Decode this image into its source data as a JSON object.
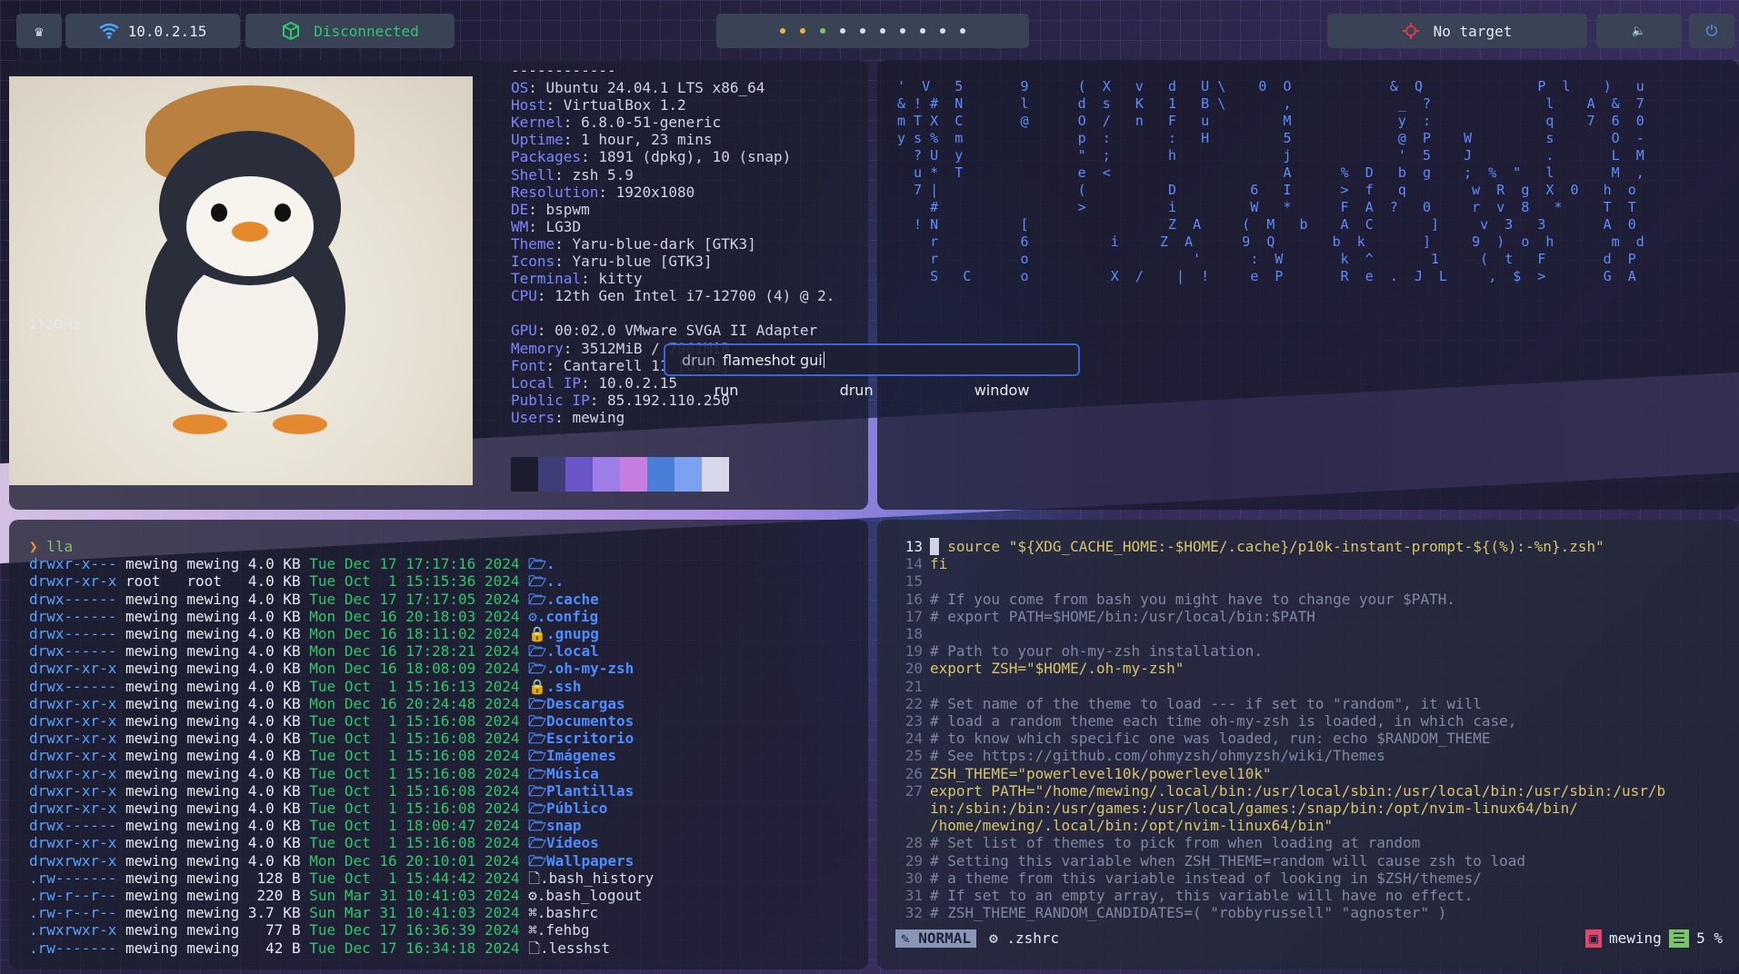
{
  "topbar": {
    "menu_icon": "♛",
    "network_ip": "10.0.2.15",
    "vpn_status": "Disconnected",
    "target_status": "No target",
    "volume_icon": "🔈",
    "power_icon": "⏻",
    "workspace_dot_colors": [
      "#e8b93a",
      "#e8b93a",
      "#7ec46a",
      "#d8dde9",
      "#d8dde9",
      "#d8dde9",
      "#d8dde9",
      "#d8dde9",
      "#d8dde9",
      "#d8dde9"
    ]
  },
  "fetch": {
    "separator": "------------",
    "lines": [
      {
        "key": "OS",
        "val": "Ubuntu 24.04.1 LTS x86_64"
      },
      {
        "key": "Host",
        "val": "VirtualBox 1.2"
      },
      {
        "key": "Kernel",
        "val": "6.8.0-51-generic"
      },
      {
        "key": "Uptime",
        "val": "1 hour, 23 mins"
      },
      {
        "key": "Packages",
        "val": "1891 (dpkg), 10 (snap)"
      },
      {
        "key": "Shell",
        "val": "zsh 5.9"
      },
      {
        "key": "Resolution",
        "val": "1920x1080"
      },
      {
        "key": "DE",
        "val": "bspwm"
      },
      {
        "key": "WM",
        "val": "LG3D"
      },
      {
        "key": "Theme",
        "val": "Yaru-blue-dark [GTK3]"
      },
      {
        "key": "Icons",
        "val": "Yaru-blue [GTK3]"
      },
      {
        "key": "Terminal",
        "val": "kitty"
      },
      {
        "key": "CPU",
        "val": "12th Gen Intel i7-12700 (4) @ 2."
      },
      {
        "key": "",
        "val": ""
      },
      {
        "key": "GPU",
        "val": "00:02.0 VMware SVGA II Adapter"
      },
      {
        "key": "Memory",
        "val": "3512MiB / 7961MiB"
      },
      {
        "key": "Font",
        "val": "Cantarell 11 [GTK3]"
      },
      {
        "key": "Local IP",
        "val": "10.0.2.15"
      },
      {
        "key": "Public IP",
        "val": "85.192.110.250"
      },
      {
        "key": "Users",
        "val": "mewing"
      }
    ],
    "ghz_label": "112GHz",
    "swatches": [
      "#1c1e30",
      "#3f3c7a",
      "#6a55c8",
      "#9e7de8",
      "#c77de0",
      "#4b7ed8",
      "#7aa2f0",
      "#d6d8ea"
    ]
  },
  "launcher": {
    "mode_prefix": "drun",
    "query": "flameshot gui",
    "modes": [
      "run",
      "drun",
      "window"
    ]
  },
  "ls": {
    "prompt_symbol": "❯",
    "command": "lla",
    "rows": [
      {
        "perm": "drwxr-x---",
        "user": "mewing",
        "group": "mewing",
        "size": "4.0 KB",
        "date": "Tue Dec 17 17:17:16 2024",
        "icon": "🗁",
        "name": ".",
        "dir": true
      },
      {
        "perm": "drwxr-xr-x",
        "user": "root",
        "group": "root",
        "size": "4.0 KB",
        "date": "Tue Oct  1 15:15:36 2024",
        "icon": "🗁",
        "name": "..",
        "dir": true
      },
      {
        "perm": "drwx------",
        "user": "mewing",
        "group": "mewing",
        "size": "4.0 KB",
        "date": "Tue Dec 17 17:17:05 2024",
        "icon": "🗁",
        "name": ".cache",
        "dir": true
      },
      {
        "perm": "drwx------",
        "user": "mewing",
        "group": "mewing",
        "size": "4.0 KB",
        "date": "Mon Dec 16 20:18:03 2024",
        "icon": "⚙",
        "name": ".config",
        "dir": true
      },
      {
        "perm": "drwx------",
        "user": "mewing",
        "group": "mewing",
        "size": "4.0 KB",
        "date": "Mon Dec 16 18:11:02 2024",
        "icon": "🔒",
        "name": ".gnupg",
        "dir": true
      },
      {
        "perm": "drwx------",
        "user": "mewing",
        "group": "mewing",
        "size": "4.0 KB",
        "date": "Mon Dec 16 17:28:21 2024",
        "icon": "🗁",
        "name": ".local",
        "dir": true
      },
      {
        "perm": "drwxr-xr-x",
        "user": "mewing",
        "group": "mewing",
        "size": "4.0 KB",
        "date": "Mon Dec 16 18:08:09 2024",
        "icon": "🗁",
        "name": ".oh-my-zsh",
        "dir": true
      },
      {
        "perm": "drwx------",
        "user": "mewing",
        "group": "mewing",
        "size": "4.0 KB",
        "date": "Tue Oct  1 15:16:13 2024",
        "icon": "🔒",
        "name": ".ssh",
        "dir": true
      },
      {
        "perm": "drwxr-xr-x",
        "user": "mewing",
        "group": "mewing",
        "size": "4.0 KB",
        "date": "Mon Dec 16 20:24:48 2024",
        "icon": "🗁",
        "name": "Descargas",
        "dir": true
      },
      {
        "perm": "drwxr-xr-x",
        "user": "mewing",
        "group": "mewing",
        "size": "4.0 KB",
        "date": "Tue Oct  1 15:16:08 2024",
        "icon": "🗁",
        "name": "Documentos",
        "dir": true
      },
      {
        "perm": "drwxr-xr-x",
        "user": "mewing",
        "group": "mewing",
        "size": "4.0 KB",
        "date": "Tue Oct  1 15:16:08 2024",
        "icon": "🗁",
        "name": "Escritorio",
        "dir": true
      },
      {
        "perm": "drwxr-xr-x",
        "user": "mewing",
        "group": "mewing",
        "size": "4.0 KB",
        "date": "Tue Oct  1 15:16:08 2024",
        "icon": "🗁",
        "name": "Imágenes",
        "dir": true
      },
      {
        "perm": "drwxr-xr-x",
        "user": "mewing",
        "group": "mewing",
        "size": "4.0 KB",
        "date": "Tue Oct  1 15:16:08 2024",
        "icon": "🗁",
        "name": "Música",
        "dir": true
      },
      {
        "perm": "drwxr-xr-x",
        "user": "mewing",
        "group": "mewing",
        "size": "4.0 KB",
        "date": "Tue Oct  1 15:16:08 2024",
        "icon": "🗁",
        "name": "Plantillas",
        "dir": true
      },
      {
        "perm": "drwxr-xr-x",
        "user": "mewing",
        "group": "mewing",
        "size": "4.0 KB",
        "date": "Tue Oct  1 15:16:08 2024",
        "icon": "🗁",
        "name": "Público",
        "dir": true
      },
      {
        "perm": "drwx------",
        "user": "mewing",
        "group": "mewing",
        "size": "4.0 KB",
        "date": "Tue Oct  1 18:00:47 2024",
        "icon": "🗁",
        "name": "snap",
        "dir": true
      },
      {
        "perm": "drwxr-xr-x",
        "user": "mewing",
        "group": "mewing",
        "size": "4.0 KB",
        "date": "Tue Oct  1 15:16:08 2024",
        "icon": "🗁",
        "name": "Vídeos",
        "dir": true
      },
      {
        "perm": "drwxrwxr-x",
        "user": "mewing",
        "group": "mewing",
        "size": "4.0 KB",
        "date": "Mon Dec 16 20:10:01 2024",
        "icon": "🗁",
        "name": "Wallpapers",
        "dir": true
      },
      {
        "perm": ".rw-------",
        "user": "mewing",
        "group": "mewing",
        "size": "128 B",
        "date": "Tue Oct  1 15:44:42 2024",
        "icon": "🗋",
        "name": ".bash_history",
        "dir": false
      },
      {
        "perm": ".rw-r--r--",
        "user": "mewing",
        "group": "mewing",
        "size": "220 B",
        "date": "Sun Mar 31 10:41:03 2024",
        "icon": "⚙",
        "name": ".bash_logout",
        "dir": false
      },
      {
        "perm": ".rw-r--r--",
        "user": "mewing",
        "group": "mewing",
        "size": "3.7 KB",
        "date": "Sun Mar 31 10:41:03 2024",
        "icon": "⌘",
        "name": ".bashrc",
        "dir": false
      },
      {
        "perm": ".rwxrwxr-x",
        "user": "mewing",
        "group": "mewing",
        "size": "77 B",
        "date": "Tue Dec 17 16:36:39 2024",
        "icon": "⌘",
        "name": ".fehbg",
        "dir": false
      },
      {
        "perm": ".rw-------",
        "user": "mewing",
        "group": "mewing",
        "size": "42 B",
        "date": "Tue Dec 17 16:34:18 2024",
        "icon": "🗋",
        "name": ".lesshst",
        "dir": false
      }
    ]
  },
  "nvim": {
    "lines": [
      {
        "n": "13",
        "cur": true,
        "html": "source",
        "rest": " \"${XDG_CACHE_HOME:-$HOME/.cache}/p10k-instant-prompt-${(%):-%n}.zsh\"",
        "type": "src"
      },
      {
        "n": "14",
        "text": "fi",
        "type": "kw"
      },
      {
        "n": "15",
        "text": "",
        "type": "var"
      },
      {
        "n": "16",
        "text": "# If you come from bash you might have to change your $PATH.",
        "type": "cm"
      },
      {
        "n": "17",
        "text": "# export PATH=$HOME/bin:/usr/local/bin:$PATH",
        "type": "cm"
      },
      {
        "n": "18",
        "text": "",
        "type": "var"
      },
      {
        "n": "19",
        "text": "# Path to your oh-my-zsh installation.",
        "type": "cm"
      },
      {
        "n": "20",
        "text": "export ZSH=\"$HOME/.oh-my-zsh\"",
        "type": "exp"
      },
      {
        "n": "21",
        "text": "",
        "type": "var"
      },
      {
        "n": "22",
        "text": "# Set name of the theme to load --- if set to \"random\", it will",
        "type": "cm"
      },
      {
        "n": "23",
        "text": "# load a random theme each time oh-my-zsh is loaded, in which case,",
        "type": "cm"
      },
      {
        "n": "24",
        "text": "# to know which specific one was loaded, run: echo $RANDOM_THEME",
        "type": "cm"
      },
      {
        "n": "25",
        "text": "# See https://github.com/ohmyzsh/ohmyzsh/wiki/Themes",
        "type": "cm"
      },
      {
        "n": "26",
        "text": "ZSH_THEME=\"powerlevel10k/powerlevel10k\"",
        "type": "exp"
      },
      {
        "n": "27",
        "text": "export PATH=\"/home/mewing/.local/bin:/usr/local/sbin:/usr/local/bin:/usr/sbin:/usr/b",
        "type": "exp"
      },
      {
        "n": "",
        "text": "in:/sbin:/bin:/usr/games:/usr/local/games:/snap/bin:/opt/nvim-linux64/bin/",
        "type": "str"
      },
      {
        "n": "",
        "text": "/home/mewing/.local/bin:/opt/nvim-linux64/bin\"",
        "type": "str"
      },
      {
        "n": "28",
        "text": "# Set list of themes to pick from when loading at random",
        "type": "cm"
      },
      {
        "n": "29",
        "text": "# Setting this variable when ZSH_THEME=random will cause zsh to load",
        "type": "cm"
      },
      {
        "n": "30",
        "text": "# a theme from this variable instead of looking in $ZSH/themes/",
        "type": "cm"
      },
      {
        "n": "31",
        "text": "# If set to an empty array, this variable will have no effect.",
        "type": "cm"
      },
      {
        "n": "32",
        "text": "# ZSH_THEME_RANDOM_CANDIDATES=( \"robbyrussell\" \"agnoster\" )",
        "type": "cm"
      }
    ],
    "status": {
      "mode": "NORMAL",
      "file": ".zshrc",
      "user": "mewing",
      "percent": "5 %"
    }
  },
  "matrix": {
    "rows": [
      "'  V   5       9      (  X   v   d   U \\    0  O            &  Q              P  l    )   u",
      "& ! #  N       l      d  s   K   1   B \\       ,             _  ?              l    A  &  7",
      "m T X  C       @      O  /   n   F   u         M             y  :              q    7  6  0",
      "y s %  m              p  :       :   H         5             @  P    W         s       O  -",
      "  ? U  y              \"  ;       h             j             '  5    J         .       L  M",
      "  u *  T              e  <                     A      %  D   b  g    ;  %  \"   l       M  ,",
      "  7 |                 (          D         6   I      >  f   q        w  R  g  X  0   h  o",
      "    #                 >          i         W   *      F  A  ?   0     r  v  8   *     T  T",
      "  ! N          [                 Z  A     (  M   b    A  C       ]     v  3   3       A  0",
      "    r          6          i     Z  A      9  Q       b  k       ]     9  )  o  h       m  d",
      "    r          o                    '      :  W       k  ^       1     (  t   F       d  P",
      "    S   C      o          X  /    |  !     e  P       R  e  .  J  L     ,  $  >       G  A"
    ]
  }
}
